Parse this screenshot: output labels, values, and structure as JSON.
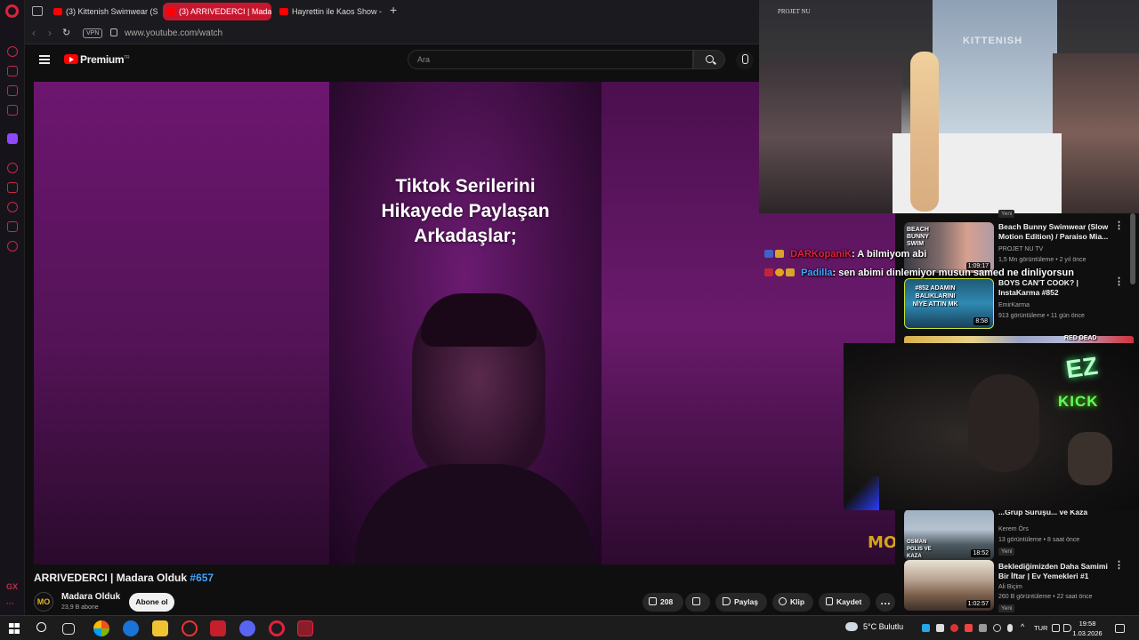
{
  "browser": {
    "tabs": [
      {
        "label": "(3) Kittenish Swimwear (Sl"
      },
      {
        "label": "(3) ARRIVEDERCI | Madara"
      },
      {
        "label": "Hayrettin ile Kaos Show - 1"
      }
    ],
    "vpn_label": "VPN",
    "url": "www.youtube.com/watch",
    "sidebar_bottom": "GX"
  },
  "youtube": {
    "brand": "Premium",
    "brand_sup": "TR",
    "search_placeholder": "Ara"
  },
  "video": {
    "caption_lines": [
      "Tiktok Serilerini",
      "Hikayede Paylaşan",
      "Arkadaşlar;"
    ],
    "watermark": "MO",
    "title": "ARRIVEDERCI | Madara Olduk",
    "hashtag": "#657",
    "channel": {
      "avatar": "MO",
      "name": "Madara Olduk",
      "subs": "23,9 B abone"
    },
    "subscribe": "Abone ol",
    "actions": {
      "likes": "208",
      "share": "Paylaş",
      "clip": "Klip",
      "save": "Kaydet"
    }
  },
  "overlay": {
    "runway_tag": "PROJET NU",
    "runway_brand": "KITTENISH",
    "chat": [
      {
        "user": "DARKopaniK",
        "user_color": "#e0213f",
        "message": ": A bilmiyom abi"
      },
      {
        "user": "Padilla",
        "user_color": "#3ea6ff",
        "message": ": sen abimi dinlemiyor musun samed ne dinliyorsun"
      }
    ],
    "neon_ez": "EZ",
    "neon_kick": "KICK"
  },
  "recommendations": [
    {
      "title": "Beach Bunny Swimwear (Slow Motion Edition) / Paraiso Mia...",
      "channel": "PROJET NU TV",
      "meta": "1,5 Mn görüntüleme • 2 yıl önce",
      "duration": "1:09:17",
      "thumb_text": "BEACH BUNNY SWIM"
    },
    {
      "title": "BOYS CAN'T COOK? | InstaKarma #852",
      "channel": "EmirKarma",
      "meta": "913 görüntüleme • 11 gün önce",
      "duration": "8:58",
      "thumb_text": "#852 ADAMIN BALIKLARINI NİYE ATTIN MK"
    },
    {
      "title": "...Grup Sürüşü... ve Kaza",
      "channel": "Kerem Örs",
      "meta": "13 görüntüleme • 8 saat önce",
      "duration": "18:52",
      "badge": "Yeni",
      "thumb_text": "OSMAN POLIS VE KAZA"
    },
    {
      "title": "Beklediğimizden Daha Samimi Bir İftar | Ev Yemekleri #1",
      "channel": "Ali Biçim",
      "meta": "260 B görüntüleme • 22 saat önce",
      "duration": "1:02:57",
      "badge": "Yeni"
    }
  ],
  "top_rec_badge": "Yeni",
  "partial_thumb_text": "RED DEAD",
  "taskbar": {
    "weather": "5°C  Bulutlu",
    "lang": "TUR",
    "time": "19:58",
    "date": "1.03.2026"
  },
  "colors": {
    "accent_red": "#c7172f",
    "link_blue": "#3ea6ff",
    "kick_green": "#53fc18"
  }
}
